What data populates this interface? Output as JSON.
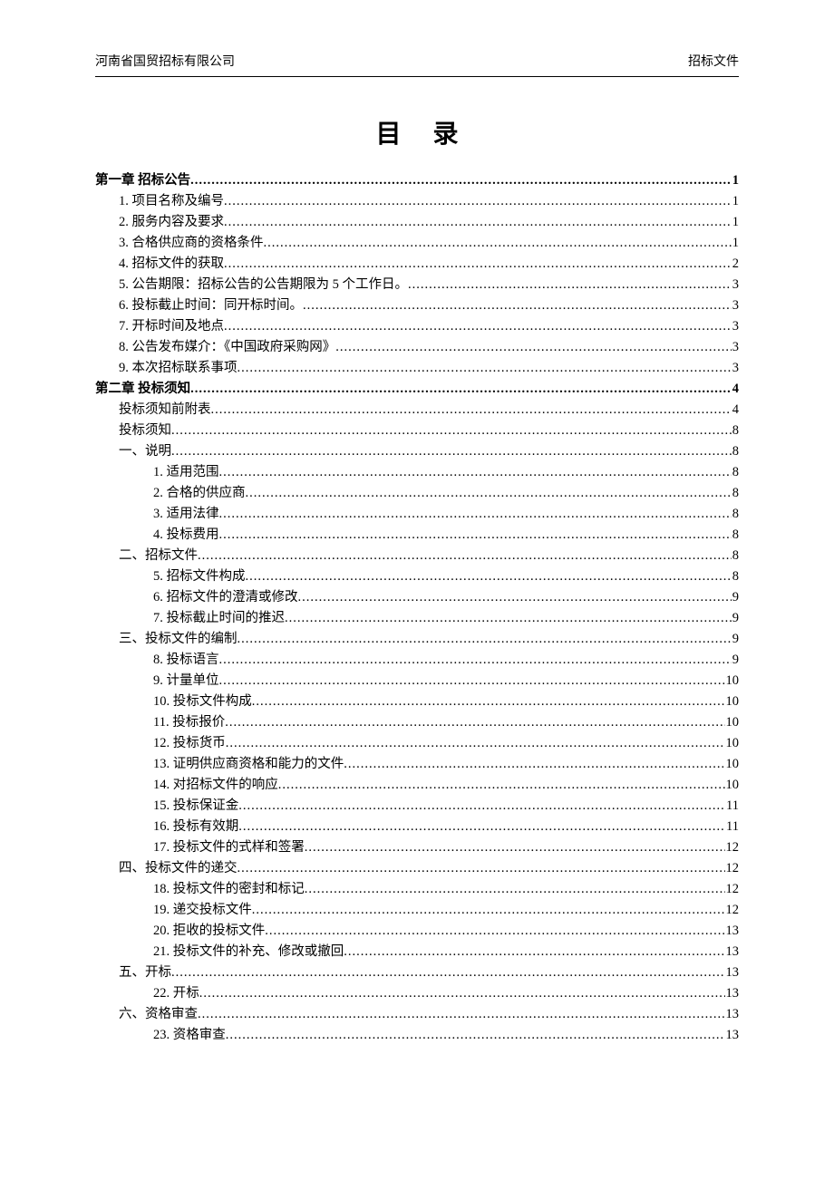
{
  "header": {
    "left": "河南省国贸招标有限公司",
    "right": "招标文件"
  },
  "title": "目 录",
  "toc": [
    {
      "label": "第一章 招标公告",
      "page": "1",
      "level": 0,
      "chapter": true
    },
    {
      "label": "1. 项目名称及编号",
      "page": "1",
      "level": 1
    },
    {
      "label": "2. 服务内容及要求",
      "page": "1",
      "level": 1
    },
    {
      "label": "3. 合格供应商的资格条件",
      "page": "1",
      "level": 1
    },
    {
      "label": "4. 招标文件的获取",
      "page": "2",
      "level": 1
    },
    {
      "label": "5. 公告期限：招标公告的公告期限为 5 个工作日。",
      "page": "3",
      "level": 1
    },
    {
      "label": "6. 投标截止时间：同开标时间。",
      "page": "3",
      "level": 1
    },
    {
      "label": "7. 开标时间及地点",
      "page": "3",
      "level": 1
    },
    {
      "label": "8. 公告发布媒介：《中国政府采购网》",
      "page": "3",
      "level": 1
    },
    {
      "label": "9. 本次招标联系事项",
      "page": "3",
      "level": 1
    },
    {
      "label": "第二章 投标须知",
      "page": "4",
      "level": 0,
      "chapter": true
    },
    {
      "label": "投标须知前附表",
      "page": "4",
      "level": 1
    },
    {
      "label": "投标须知",
      "page": "8",
      "level": 1
    },
    {
      "label": "一、说明",
      "page": "8",
      "level": 1
    },
    {
      "label": "1. 适用范围",
      "page": "8",
      "level": 2
    },
    {
      "label": "2. 合格的供应商",
      "page": "8",
      "level": 2
    },
    {
      "label": "3. 适用法律",
      "page": "8",
      "level": 2
    },
    {
      "label": "4. 投标费用",
      "page": "8",
      "level": 2
    },
    {
      "label": "二、招标文件",
      "page": "8",
      "level": 1
    },
    {
      "label": "5. 招标文件构成",
      "page": "8",
      "level": 2
    },
    {
      "label": "6. 招标文件的澄清或修改",
      "page": "9",
      "level": 2
    },
    {
      "label": "7. 投标截止时间的推迟",
      "page": "9",
      "level": 2
    },
    {
      "label": "三、投标文件的编制",
      "page": "9",
      "level": 1
    },
    {
      "label": "8. 投标语言",
      "page": "9",
      "level": 2
    },
    {
      "label": "9. 计量单位",
      "page": "10",
      "level": 2
    },
    {
      "label": "10. 投标文件构成",
      "page": "10",
      "level": 2
    },
    {
      "label": "11. 投标报价",
      "page": "10",
      "level": 2
    },
    {
      "label": "12. 投标货币",
      "page": "10",
      "level": 2
    },
    {
      "label": "13. 证明供应商资格和能力的文件",
      "page": "10",
      "level": 2
    },
    {
      "label": "14. 对招标文件的响应",
      "page": "10",
      "level": 2
    },
    {
      "label": "15. 投标保证金",
      "page": "11",
      "level": 2
    },
    {
      "label": "16. 投标有效期",
      "page": "11",
      "level": 2
    },
    {
      "label": "17. 投标文件的式样和签署",
      "page": "12",
      "level": 2
    },
    {
      "label": "四、投标文件的递交",
      "page": "12",
      "level": 1
    },
    {
      "label": "18. 投标文件的密封和标记",
      "page": "12",
      "level": 2
    },
    {
      "label": "19. 递交投标文件",
      "page": "12",
      "level": 2
    },
    {
      "label": "20. 拒收的投标文件",
      "page": "13",
      "level": 2
    },
    {
      "label": "21. 投标文件的补充、修改或撤回",
      "page": "13",
      "level": 2
    },
    {
      "label": "五、开标",
      "page": "13",
      "level": 1
    },
    {
      "label": "22. 开标",
      "page": "13",
      "level": 2
    },
    {
      "label": "六、资格审查",
      "page": "13",
      "level": 1
    },
    {
      "label": "23. 资格审查",
      "page": "13",
      "level": 2
    }
  ]
}
